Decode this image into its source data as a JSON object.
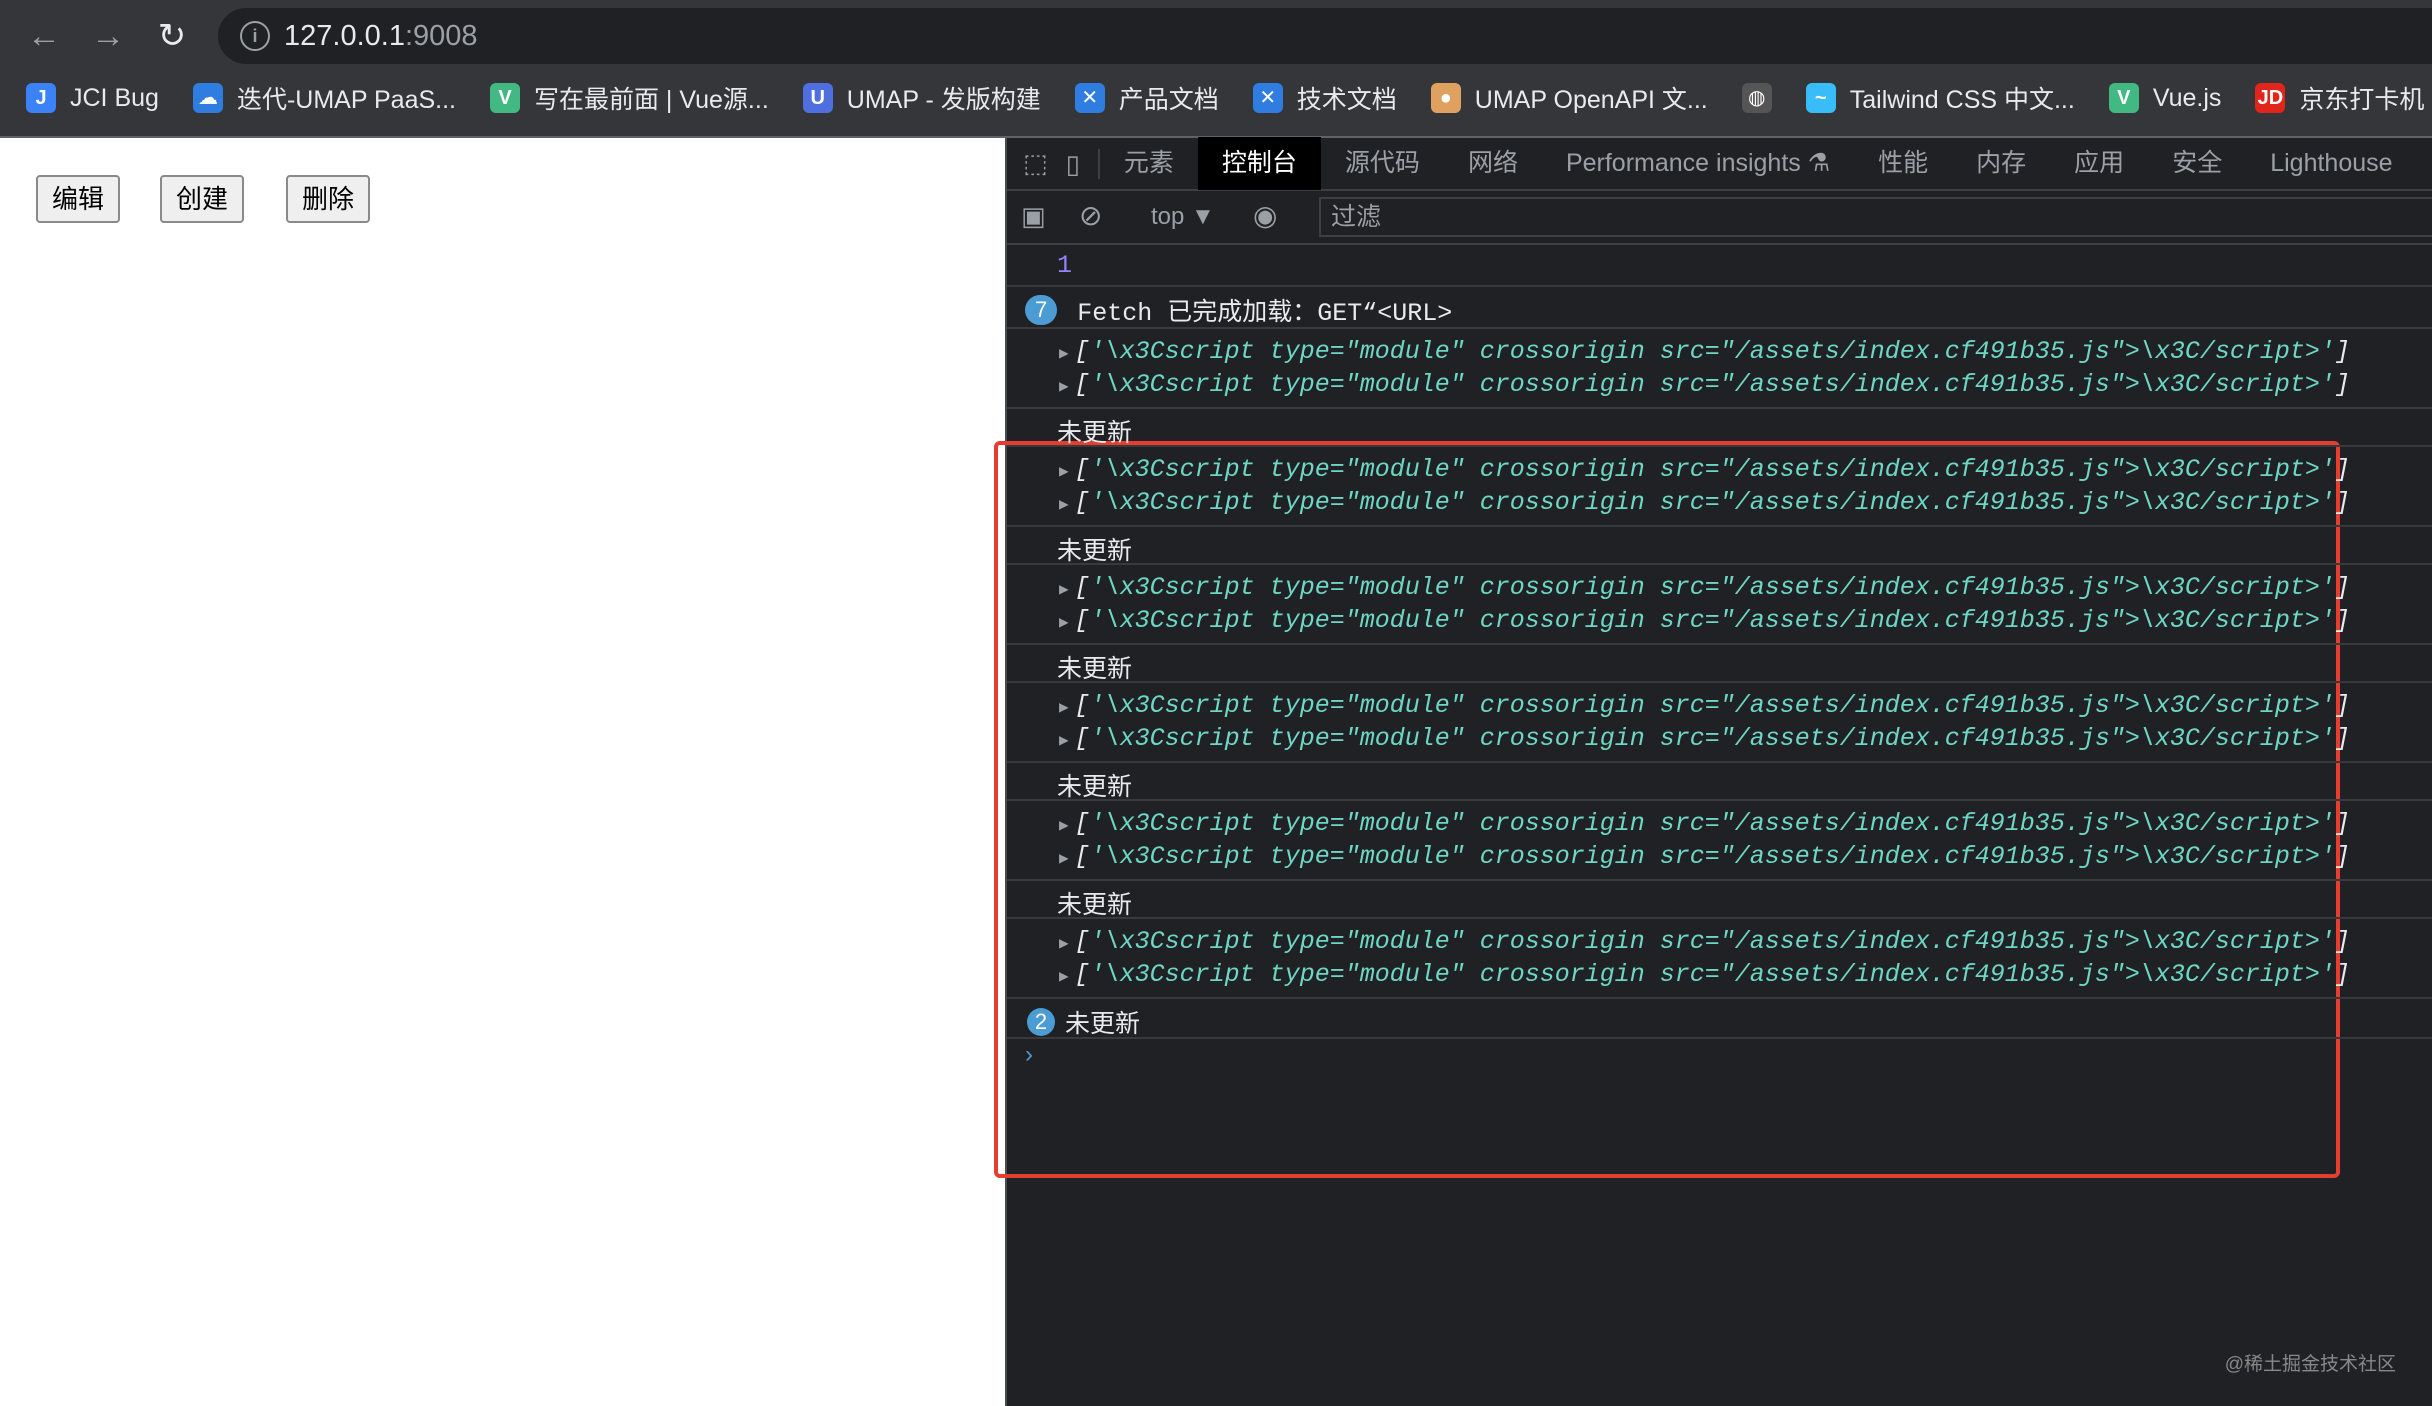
{
  "browser": {
    "url_host": "127.0.0.1",
    "url_port": ":9008",
    "bookmarks": [
      {
        "label": "JCI Bug",
        "icon": "J",
        "color": "#3b82f6"
      },
      {
        "label": "迭代-UMAP PaaS...",
        "icon": "☁",
        "color": "#2f7de1"
      },
      {
        "label": "写在最前面 | Vue源...",
        "icon": "V",
        "color": "#42b883"
      },
      {
        "label": "UMAP - 发版构建",
        "icon": "U",
        "color": "#4f6fe0"
      },
      {
        "label": "产品文档",
        "icon": "✕",
        "color": "#2f7de1"
      },
      {
        "label": "技术文档",
        "icon": "✕",
        "color": "#2f7de1"
      },
      {
        "label": "UMAP OpenAPI 文...",
        "icon": "●",
        "color": "#e0a060"
      },
      {
        "label": "",
        "icon": "◍",
        "color": "#555"
      },
      {
        "label": "Tailwind CSS 中文...",
        "icon": "~",
        "color": "#38bdf8"
      },
      {
        "label": "Vue.js",
        "icon": "V",
        "color": "#42b883"
      },
      {
        "label": "京东打卡机",
        "icon": "JD",
        "color": "#e1251b"
      }
    ]
  },
  "page": {
    "buttons": [
      "编辑",
      "创建",
      "删除"
    ]
  },
  "devtools": {
    "tabs": [
      "元素",
      "控制台",
      "源代码",
      "网络",
      "Performance insights ⚗",
      "性能",
      "内存",
      "应用",
      "安全",
      "Lighthouse"
    ],
    "context": "top ▼",
    "filter_placeholder": "过滤",
    "console": {
      "first": "1",
      "fetch_count": "7",
      "fetch_text": "Fetch 已完成加载：GET“<URL>",
      "script_line": "'\\x3Cscript type=\"module\" crossorigin src=\"/assets/index.cf491b35.js\">\\x3C/script>'",
      "not_updated": "未更新",
      "last_count": "2"
    }
  },
  "watermark": "@稀土掘金技术社区"
}
